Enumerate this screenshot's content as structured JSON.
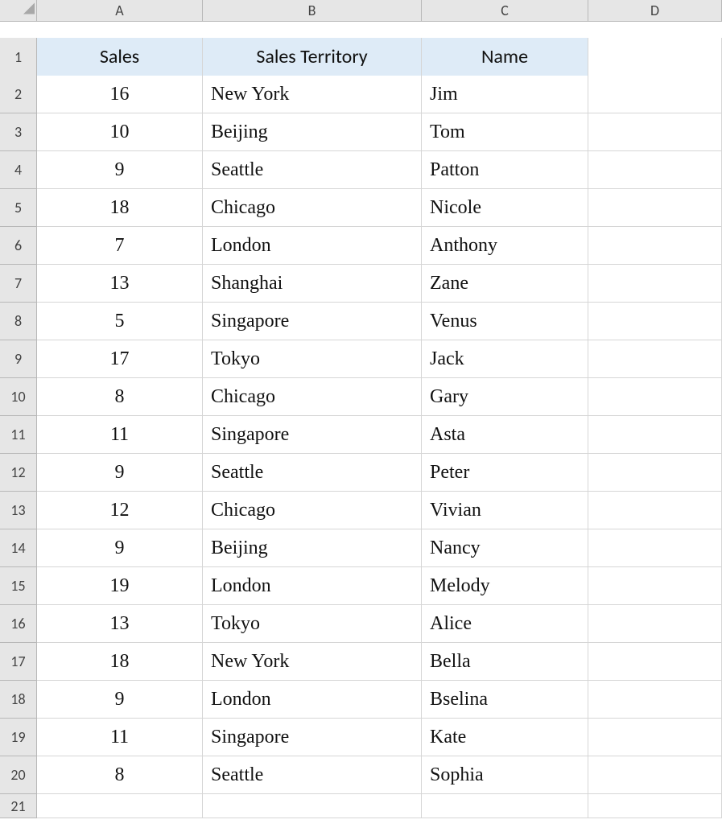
{
  "columns": [
    "A",
    "B",
    "C",
    "D"
  ],
  "row_numbers": [
    "1",
    "2",
    "3",
    "4",
    "5",
    "6",
    "7",
    "8",
    "9",
    "10",
    "11",
    "12",
    "13",
    "14",
    "15",
    "16",
    "17",
    "18",
    "19",
    "20",
    "21"
  ],
  "headers": {
    "A": "Sales",
    "B": "Sales Territory",
    "C": "Name",
    "D": ""
  },
  "rows": [
    {
      "A": "16",
      "B": "New York",
      "C": "Jim",
      "D": ""
    },
    {
      "A": "10",
      "B": "Beijing",
      "C": "Tom",
      "D": ""
    },
    {
      "A": "9",
      "B": "Seattle",
      "C": "Patton",
      "D": ""
    },
    {
      "A": "18",
      "B": "Chicago",
      "C": "Nicole",
      "D": ""
    },
    {
      "A": "7",
      "B": "London",
      "C": "Anthony",
      "D": ""
    },
    {
      "A": "13",
      "B": "Shanghai",
      "C": "Zane",
      "D": ""
    },
    {
      "A": "5",
      "B": "Singapore",
      "C": "Venus",
      "D": ""
    },
    {
      "A": "17",
      "B": "Tokyo",
      "C": "Jack",
      "D": ""
    },
    {
      "A": "8",
      "B": "Chicago",
      "C": "Gary",
      "D": ""
    },
    {
      "A": "11",
      "B": "Singapore",
      "C": "Asta",
      "D": ""
    },
    {
      "A": "9",
      "B": "Seattle",
      "C": "Peter",
      "D": ""
    },
    {
      "A": "12",
      "B": "Chicago",
      "C": "Vivian",
      "D": ""
    },
    {
      "A": "9",
      "B": "Beijing",
      "C": "Nancy",
      "D": ""
    },
    {
      "A": "19",
      "B": "London",
      "C": "Melody",
      "D": ""
    },
    {
      "A": "13",
      "B": "Tokyo",
      "C": "Alice",
      "D": ""
    },
    {
      "A": "18",
      "B": "New York",
      "C": "Bella",
      "D": ""
    },
    {
      "A": "9",
      "B": "London",
      "C": "Bselina",
      "D": ""
    },
    {
      "A": "11",
      "B": "Singapore",
      "C": "Kate",
      "D": ""
    },
    {
      "A": "8",
      "B": "Seattle",
      "C": "Sophia",
      "D": ""
    }
  ]
}
